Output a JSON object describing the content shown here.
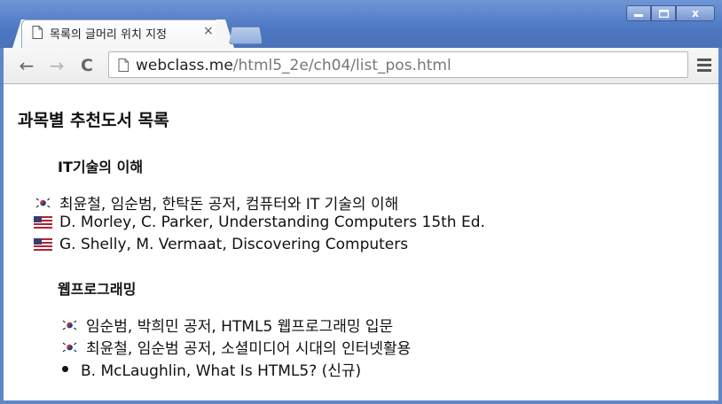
{
  "window": {
    "tab_title": "목록의 글머리 위치 지정",
    "tab_close": "×",
    "controls": {
      "minimize": "–",
      "maximize": "□",
      "close": "x"
    }
  },
  "toolbar": {
    "back": "←",
    "forward": "→",
    "reload": "C",
    "url_host": "webclass.me",
    "url_path": "/html5_2e/ch04/list_pos.html"
  },
  "page": {
    "title": "과목별 추천도서 목록",
    "sections": [
      {
        "heading": "IT기술의 이해",
        "items": [
          {
            "flag": "korea-flag-icon",
            "text": "최윤철, 임순범, 한탁돈 공저, 컴퓨터와 IT 기술의 이해"
          },
          {
            "flag": "us-flag-icon",
            "text": "D. Morley, C. Parker, Understanding Computers 15th Ed."
          },
          {
            "flag": "us-flag-icon",
            "text": "G. Shelly, M. Vermaat, Discovering Computers"
          }
        ]
      },
      {
        "heading": "웹프로그래밍",
        "items": [
          {
            "flag": "korea-flag-icon",
            "text": "임순범, 박희민 공저, HTML5 웹프로그래밍 입문"
          },
          {
            "flag": "korea-flag-icon",
            "text": "최윤철, 임순범 공저, 소셜미디어 시대의 인터넷활용"
          },
          {
            "flag": "bullet-icon",
            "text": "B. McLaughlin, What Is HTML5? (신규)"
          }
        ]
      }
    ]
  },
  "colors": {
    "titlebar": "#5f86c8",
    "url_host": "#222222",
    "url_path": "#777777"
  }
}
